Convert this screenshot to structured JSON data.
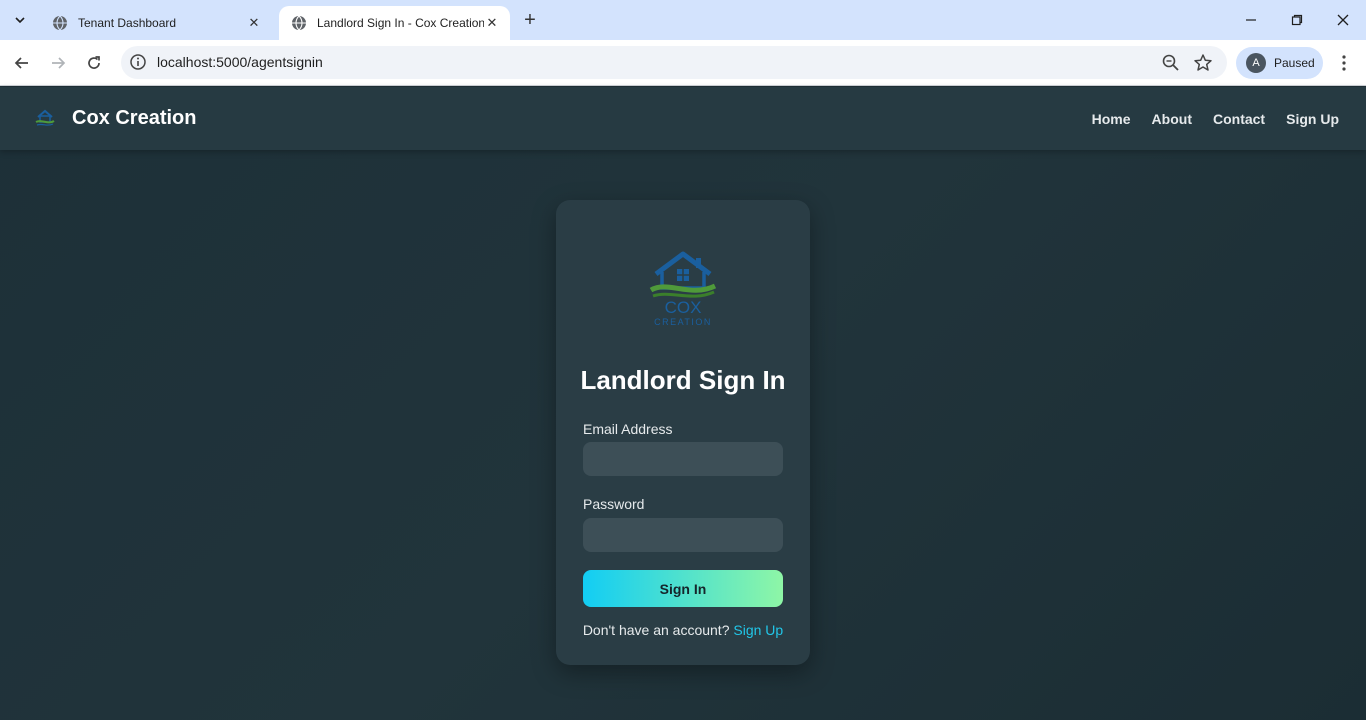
{
  "browser": {
    "tabs": [
      {
        "title": "Tenant Dashboard",
        "active": false
      },
      {
        "title": "Landlord Sign In - Cox Creation",
        "active": true
      }
    ],
    "url": "localhost:5000/agentsignin",
    "profile": {
      "initial": "A",
      "status": "Paused"
    }
  },
  "navbar": {
    "brand": "Cox Creation",
    "links": [
      "Home",
      "About",
      "Contact",
      "Sign Up"
    ]
  },
  "form": {
    "title": "Landlord Sign In",
    "email_label": "Email Address",
    "email_value": "",
    "password_label": "Password",
    "password_value": "",
    "submit_label": "Sign In",
    "footer_prompt": "Don't have an account?",
    "footer_link": "Sign Up"
  },
  "logo": {
    "line1": "COX",
    "line2": "CREATION"
  },
  "colors": {
    "page_bg": "#1f3038",
    "navbar_bg": "#263a42",
    "card_bg": "#2a3d45",
    "input_bg": "#3d4f57",
    "button_gradient_start": "#12cdf4",
    "button_gradient_end": "#8ef6a6",
    "link": "#21c6e8",
    "logo_blue": "#1a5f9e",
    "logo_green": "#4f9a3a"
  }
}
